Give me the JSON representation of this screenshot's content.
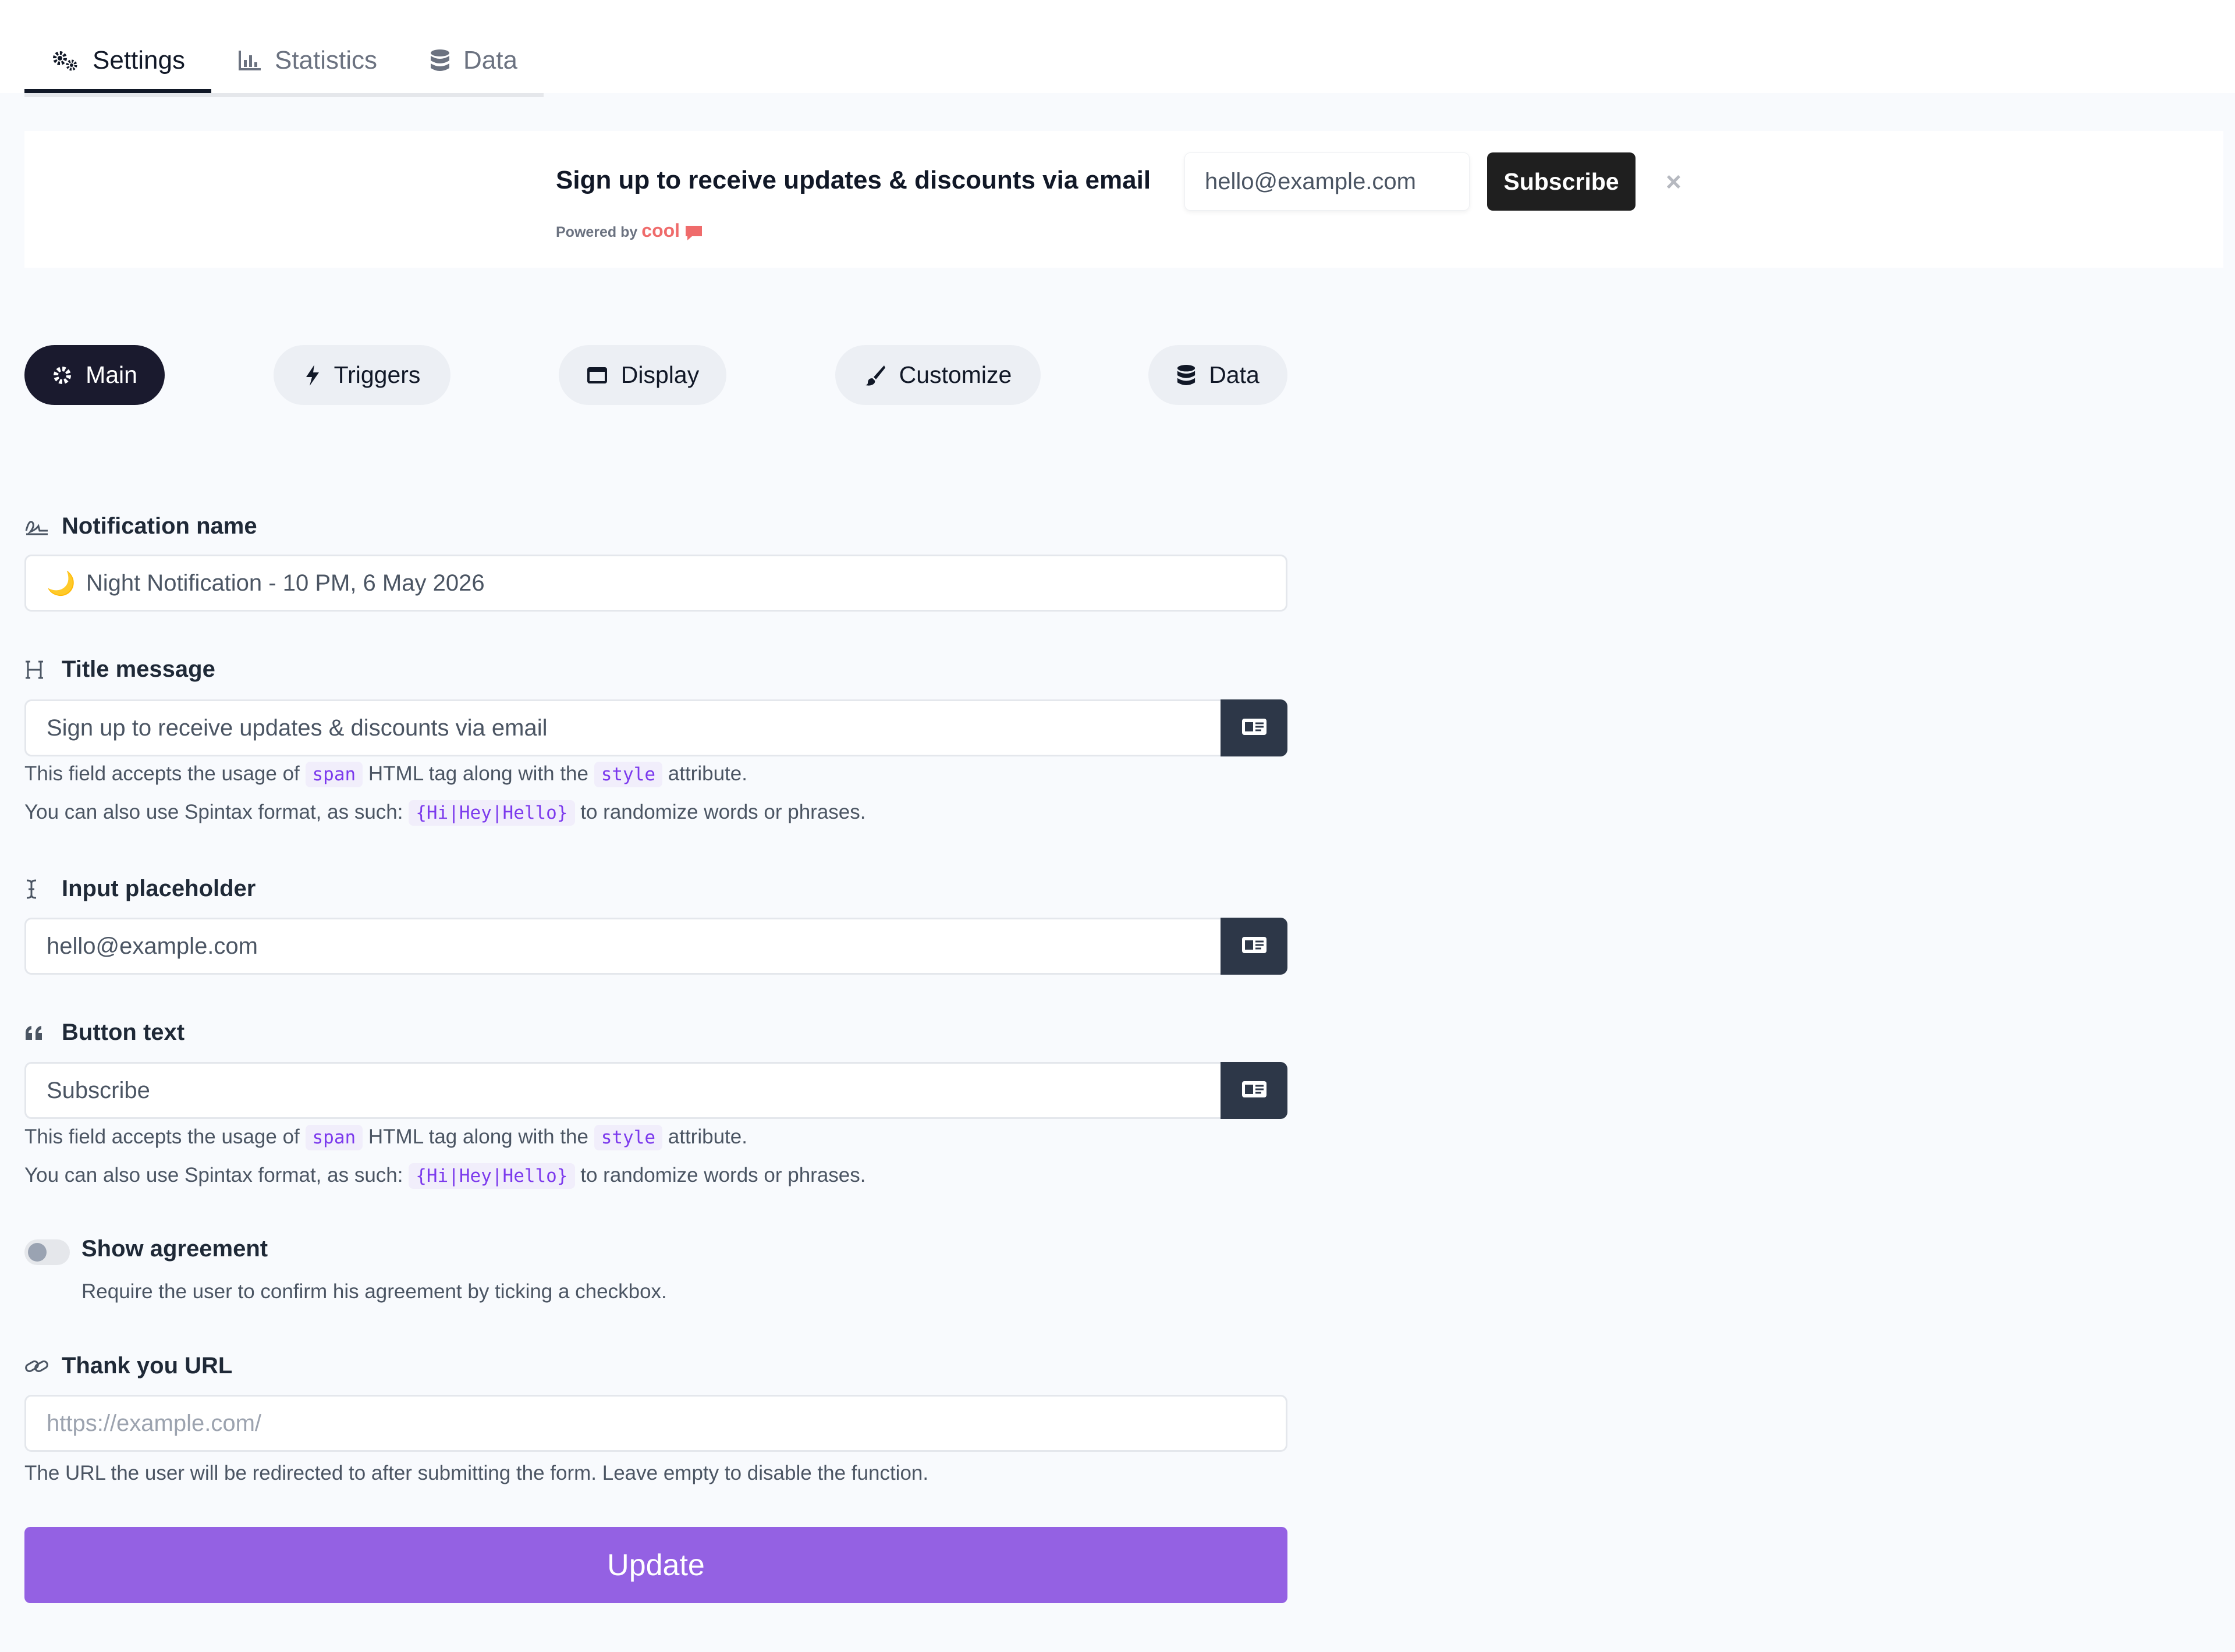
{
  "top_tabs": [
    {
      "label": "Settings",
      "icon": "gears-icon",
      "active": true
    },
    {
      "label": "Statistics",
      "icon": "chart-icon",
      "active": false
    },
    {
      "label": "Data",
      "icon": "database-icon",
      "active": false
    }
  ],
  "banner": {
    "title": "Sign up to receive updates & discounts via email",
    "powered_by": "Powered by",
    "powered_brand": "cool",
    "input_placeholder": "hello@example.com",
    "button": "Subscribe",
    "close": "×"
  },
  "pills": [
    {
      "label": "Main",
      "icon": "gear-icon",
      "active": true
    },
    {
      "label": "Triggers",
      "icon": "bolt-icon",
      "active": false
    },
    {
      "label": "Display",
      "icon": "window-icon",
      "active": false
    },
    {
      "label": "Customize",
      "icon": "brush-icon",
      "active": false
    },
    {
      "label": "Data",
      "icon": "database-icon",
      "active": false
    }
  ],
  "form": {
    "notification_name": {
      "label": "Notification name",
      "emoji": "🌙",
      "value": "Night Notification - 10 PM, 6 May 2026"
    },
    "title_message": {
      "label": "Title message",
      "value": "Sign up to receive updates & discounts via email"
    },
    "help_span": {
      "pre": "This field accepts the usage of",
      "code1": "span",
      "mid": "HTML tag along with the",
      "code2": "style",
      "post": "attribute."
    },
    "help_spintax": {
      "pre": "You can also use Spintax format, as such:",
      "code": "{Hi|Hey|Hello}",
      "post": "to randomize words or phrases."
    },
    "input_placeholder": {
      "label": "Input placeholder",
      "value": "hello@example.com"
    },
    "button_text": {
      "label": "Button text",
      "value": "Subscribe"
    },
    "agreement": {
      "label": "Show agreement",
      "help": "Require the user to confirm his agreement by ticking a checkbox.",
      "enabled": false
    },
    "thank_you_url": {
      "label": "Thank you URL",
      "placeholder": "https://example.com/",
      "help": "The URL the user will be redirected to after submitting the form. Leave empty to disable the function."
    },
    "submit": "Update"
  }
}
